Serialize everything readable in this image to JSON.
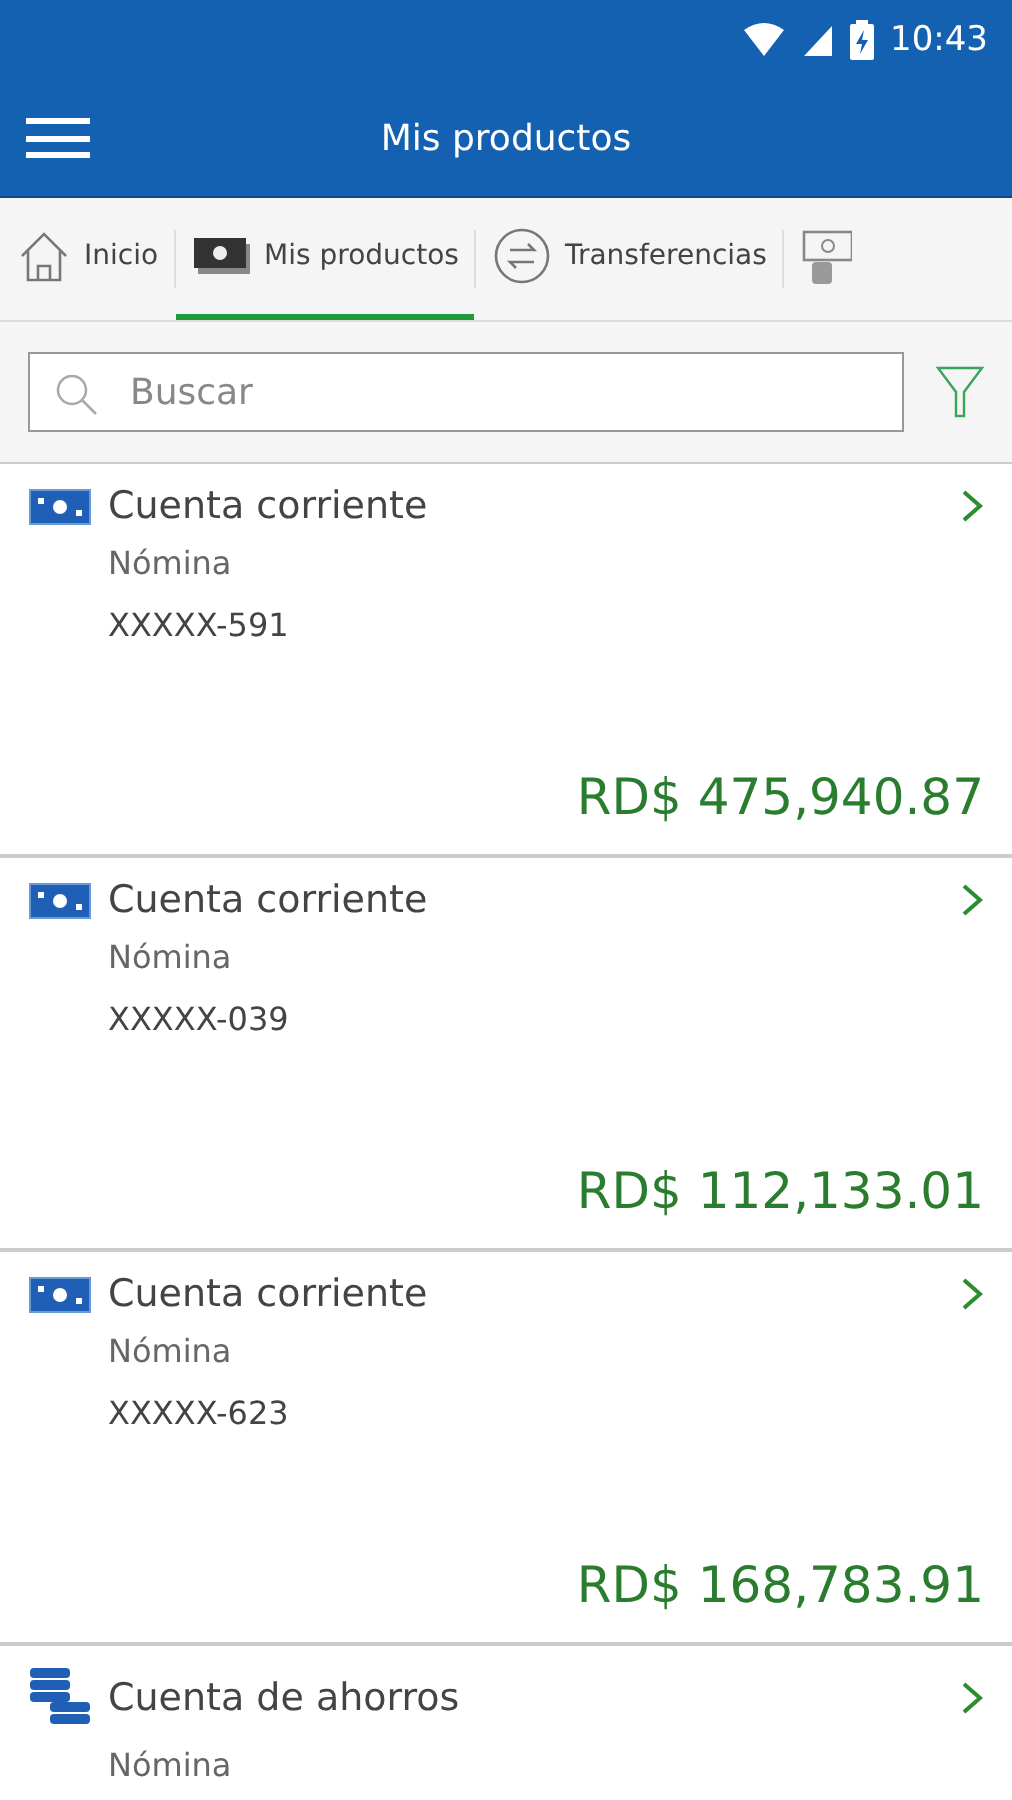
{
  "status_bar": {
    "time": "10:43"
  },
  "app_bar": {
    "title": "Mis productos"
  },
  "tabs": [
    {
      "kind": "home",
      "label": "Inicio",
      "selected": false
    },
    {
      "kind": "cash",
      "label": "Mis productos",
      "selected": true
    },
    {
      "kind": "transfer",
      "label": "Transferencias",
      "selected": false
    },
    {
      "kind": "payment",
      "selected": false
    }
  ],
  "search": {
    "placeholder": "Buscar"
  },
  "products": [
    {
      "kind": "checking",
      "name": "Cuenta corriente",
      "subtitle": "Nómina",
      "account": "XXXXX-591",
      "amount": "RD$ 475,940.87"
    },
    {
      "kind": "checking",
      "name": "Cuenta corriente",
      "subtitle": "Nómina",
      "account": "XXXXX-039",
      "amount": "RD$ 112,133.01"
    },
    {
      "kind": "checking",
      "name": "Cuenta corriente",
      "subtitle": "Nómina",
      "account": "XXXXX-623",
      "amount": "RD$ 168,783.91"
    },
    {
      "kind": "savings",
      "name": "Cuenta de ahorros",
      "subtitle": "Nómina"
    }
  ]
}
